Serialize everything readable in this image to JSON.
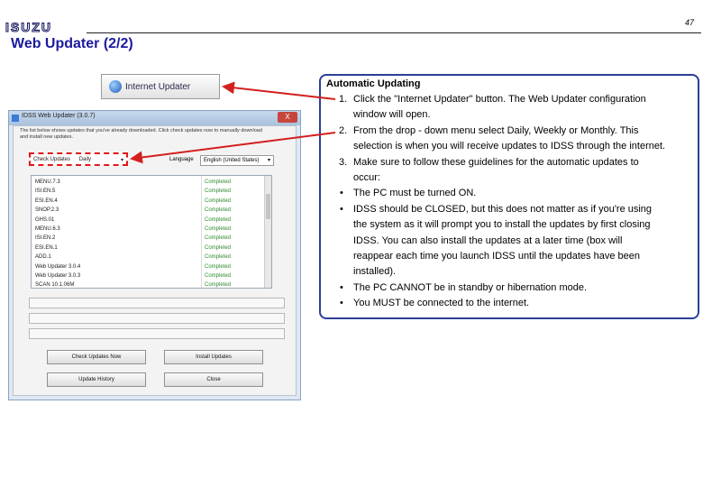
{
  "header": {
    "logo_text": "ISUZU",
    "page_number": "47",
    "title": "Web Updater (2/2)"
  },
  "internet_updater_button": {
    "label": "Internet Updater"
  },
  "dialog": {
    "title": "IDSS Web Updater (3.0.7)",
    "close_label": "X",
    "description": "The list below shows updates that you've already downloaded. Click check updates now to manually download and install new updates.",
    "check_updates_label": "Check Updates",
    "check_updates_value": "Daily",
    "language_label": "Language",
    "language_value": "English (United States)",
    "updates": [
      {
        "name": "MENU.7.3",
        "status": "Completed"
      },
      {
        "name": "ISI.EN.5",
        "status": "Completed"
      },
      {
        "name": "ESI.EN.4",
        "status": "Completed"
      },
      {
        "name": "SNOP.2.3",
        "status": "Completed"
      },
      {
        "name": "GHS.01",
        "status": "Completed"
      },
      {
        "name": "MENU.6.3",
        "status": "Completed"
      },
      {
        "name": "ISI.EN.2",
        "status": "Completed"
      },
      {
        "name": "ESI.EN.1",
        "status": "Completed"
      },
      {
        "name": "ADD.1",
        "status": "Completed"
      },
      {
        "name": "Web Updater 3.0.4",
        "status": "Completed"
      },
      {
        "name": "Web Updater 3.0.3",
        "status": "Completed"
      },
      {
        "name": "SCAN 10.1.06M",
        "status": "Completed"
      }
    ],
    "buttons": {
      "check_updates_now": "Check Updates Now",
      "install_updates": "Install Updates",
      "update_history": "Update History",
      "close": "Close"
    }
  },
  "instructions": {
    "heading": "Automatic Updating",
    "steps": [
      {
        "num": "1.",
        "lines": [
          "Click the \"Internet Updater\" button.  The Web Updater configuration",
          "window will open."
        ]
      },
      {
        "num": "2.",
        "lines": [
          "From the drop - down menu select Daily, Weekly or Monthly.  This",
          "selection is when you will receive updates to IDSS through the internet."
        ]
      },
      {
        "num": "3.",
        "lines": [
          "Make sure to follow these guidelines for the automatic updates to",
          "occur:"
        ]
      }
    ],
    "bullets": [
      {
        "lines": [
          "The PC must be turned ON."
        ]
      },
      {
        "lines": [
          "IDSS should be CLOSED, but this does not matter as if you're using",
          "the system as it will prompt you to install the updates by first closing",
          "IDSS.  You can also install the updates at a later time (box will",
          "reappear each time you launch IDSS until the updates have been",
          "installed)."
        ]
      },
      {
        "lines": [
          "The PC CANNOT be in standby or hibernation mode."
        ]
      },
      {
        "lines": [
          "You MUST be connected to the internet."
        ]
      }
    ]
  },
  "colors": {
    "title_blue": "#1a1aa0",
    "panel_border": "#2b3f9a",
    "arrow_red": "#d41f1f",
    "completed_green": "#2f8a2f"
  }
}
